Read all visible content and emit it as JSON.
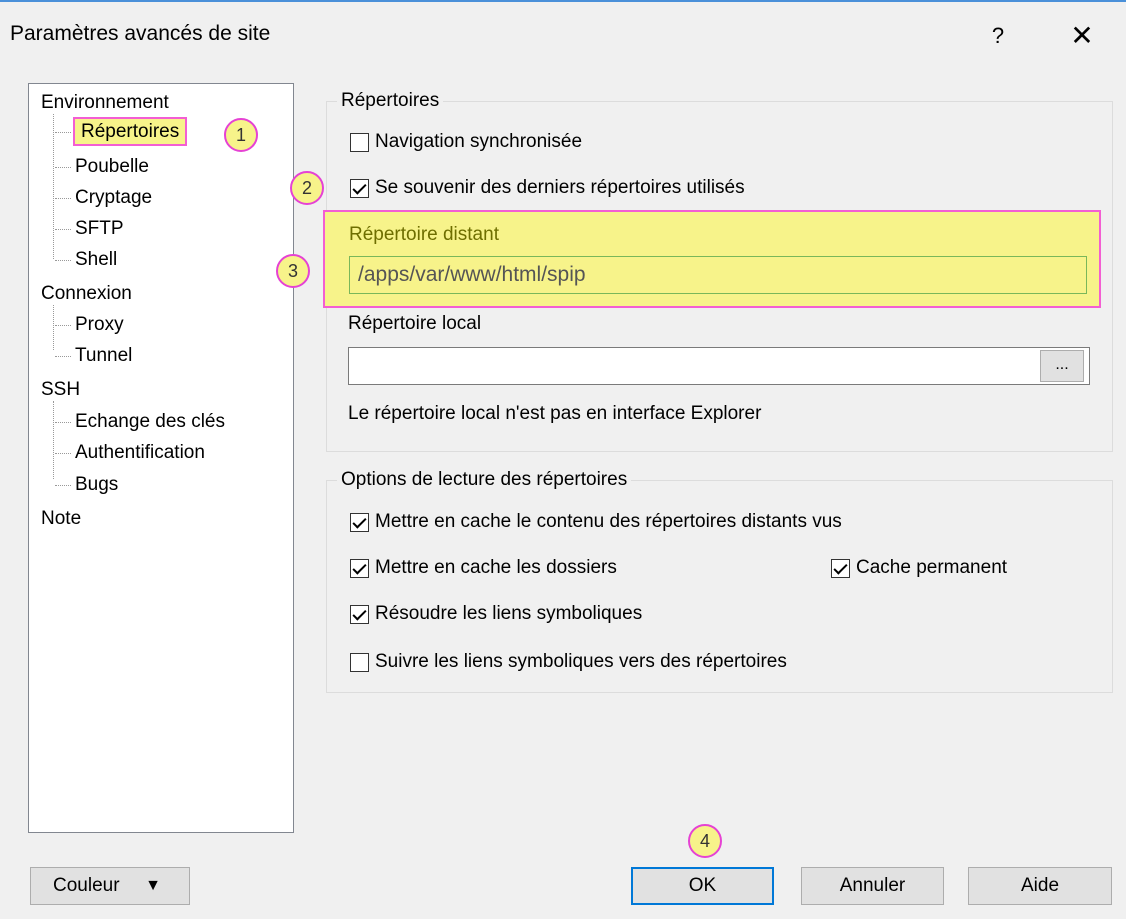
{
  "window": {
    "title": "Paramètres avancés de site",
    "help": "?",
    "close": "✕"
  },
  "tree": {
    "env": "Environnement",
    "env_children": [
      "Répertoires",
      "Poubelle",
      "Cryptage",
      "SFTP",
      "Shell"
    ],
    "conn": "Connexion",
    "conn_children": [
      "Proxy",
      "Tunnel"
    ],
    "ssh": "SSH",
    "ssh_children": [
      "Echange des clés",
      "Authentification",
      "Bugs"
    ],
    "note": "Note"
  },
  "directories": {
    "group_label": "Répertoires",
    "sync_nav": {
      "label": "Navigation synchronisée",
      "checked": false
    },
    "remember": {
      "label": "Se souvenir des derniers répertoires utilisés",
      "checked": true
    },
    "remote_label": "Répertoire distant",
    "remote_value": "/apps/var/www/html/spip",
    "local_label": "Répertoire local",
    "local_value": "",
    "browse": "...",
    "info": "Le répertoire local n'est pas en interface Explorer"
  },
  "read_options": {
    "group_label": "Options de lecture des répertoires",
    "cache_content": {
      "label": "Mettre en cache le contenu des répertoires distants vus",
      "checked": true
    },
    "cache_folders": {
      "label": "Mettre en cache les dossiers",
      "checked": true
    },
    "permanent": {
      "label": "Cache permanent",
      "checked": true
    },
    "resolve": {
      "label": "Résoudre les liens symboliques",
      "checked": true
    },
    "follow": {
      "label": "Suivre les liens symboliques vers des répertoires",
      "checked": false
    }
  },
  "annotations": [
    "1",
    "2",
    "3",
    "4"
  ],
  "buttons": {
    "color": "Couleur",
    "color_arrow": "▼",
    "ok": "OK",
    "cancel": "Annuler",
    "help": "Aide"
  },
  "colors": {
    "highlight": "#f7f38a",
    "annotation": "#f35ed3",
    "focus": "#0078d7"
  }
}
